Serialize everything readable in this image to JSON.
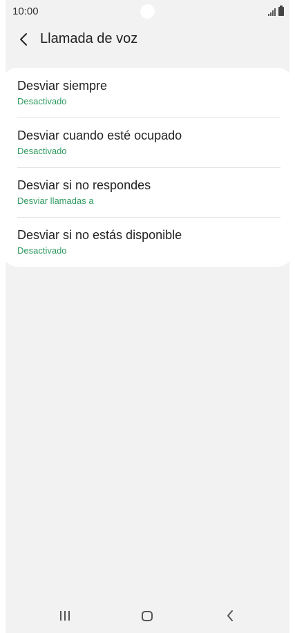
{
  "status_bar": {
    "time": "10:00",
    "icons": [
      "signal-icon",
      "battery-icon"
    ]
  },
  "header": {
    "back_icon": "chevron-left-icon",
    "title": "Llamada de voz"
  },
  "items": [
    {
      "title": "Desviar siempre",
      "subtitle": "Desactivado"
    },
    {
      "title": "Desviar cuando esté ocupado",
      "subtitle": "Desactivado"
    },
    {
      "title": "Desviar si no respondes",
      "subtitle": "Desviar llamadas a"
    },
    {
      "title": "Desviar si no estás disponible",
      "subtitle": "Desactivado"
    }
  ],
  "nav_bar": {
    "recents_icon": "recents-icon",
    "home_icon": "home-icon",
    "back_icon": "back-icon"
  },
  "colors": {
    "accent_subtitle": "#2e9a5f",
    "background": "#f2f2f2",
    "card": "#ffffff"
  }
}
